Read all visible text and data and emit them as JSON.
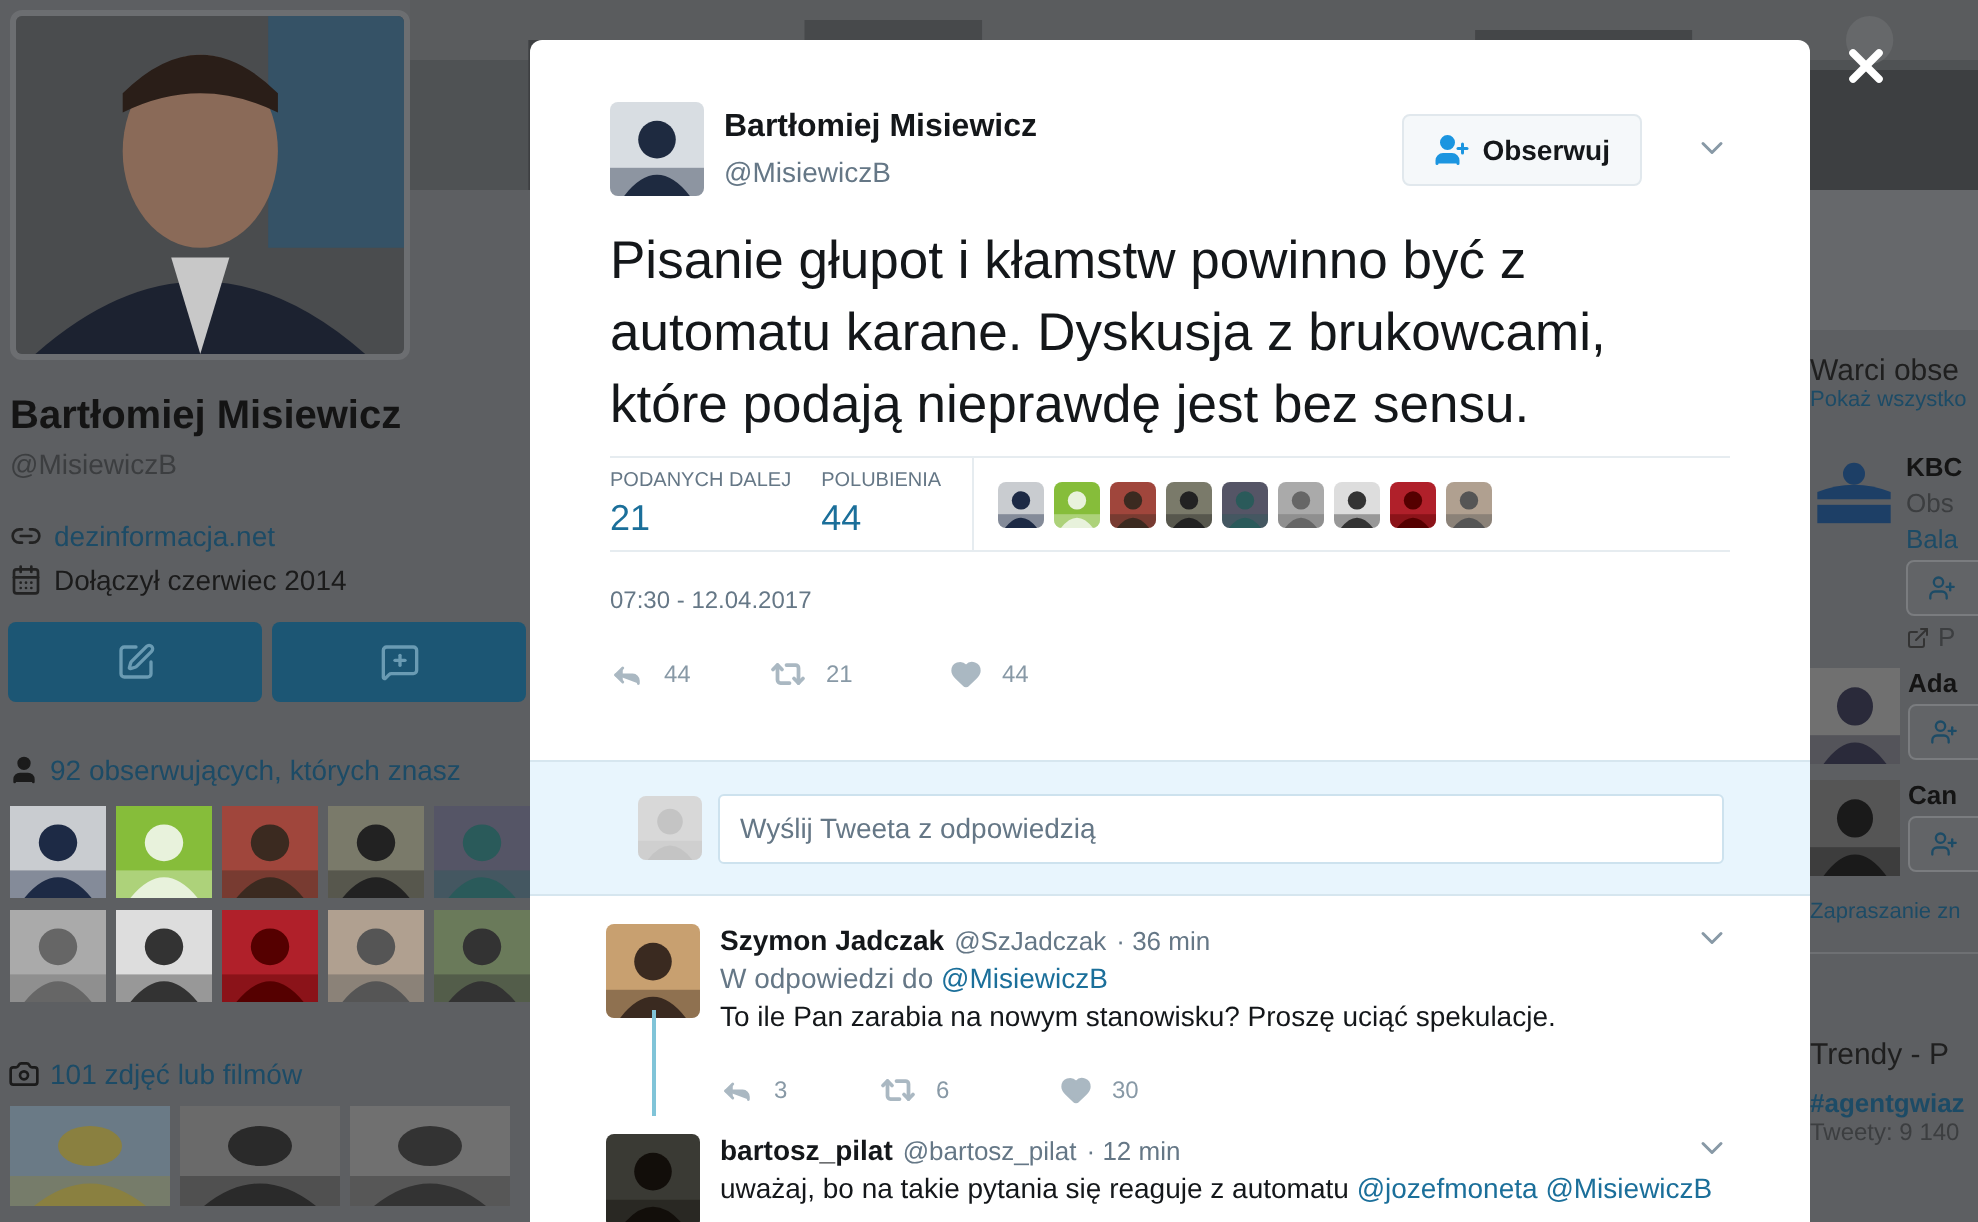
{
  "profile": {
    "name": "Bartłomiej Misiewicz",
    "handle": "@MisiewiczB",
    "link": "dezinformacja.net",
    "joined": "Dołączył czerwiec 2014",
    "followers_label": "92 obserwujących, których znasz",
    "media_label": "101 zdjęć lub filmów"
  },
  "right_column": {
    "title": "Warci obse",
    "show_all": "Pokaż wszystko",
    "suggestions": [
      {
        "kind": "logo",
        "name": "KBC",
        "line_2": "Obs",
        "line_3": "Bala",
        "promoted": "P"
      },
      {
        "kind": "person",
        "name": "Ada"
      },
      {
        "kind": "person",
        "name": "Can"
      }
    ],
    "invite": "Zapraszanie zn",
    "trends_title": "Trendy - P",
    "trend": "#agentgwiaz",
    "trend_count": "Tweety: 9 140"
  },
  "tweet": {
    "name": "Bartłomiej Misiewicz",
    "handle": "@MisiewiczB",
    "follow_label": "Obserwuj",
    "text": "Pisanie głupot i kłamstw powinno być z automatu karane. Dyskusja z brukowcami, które podają nieprawdę jest bez sensu.",
    "stats": [
      {
        "label": "PODANYCH DALEJ",
        "value": "21"
      },
      {
        "label": "POLUBIENIA",
        "value": "44"
      }
    ],
    "date": "07:30 - 12.04.2017",
    "actions": {
      "replies": "44",
      "retweets": "21",
      "likes": "44"
    }
  },
  "reply_box": {
    "placeholder": "Wyślij Tweeta z odpowiedzią"
  },
  "replies": [
    {
      "name": "Szymon Jadczak",
      "handle": "@SzJadczak",
      "time": "· 36 min",
      "reply_to_prefix": "W odpowiedzi do",
      "reply_to": "@MisiewiczB",
      "text": "To ile Pan zarabia na nowym stanowisku? Proszę uciąć spekulacje.",
      "actions": {
        "replies": "3",
        "retweets": "6",
        "likes": "30"
      }
    },
    {
      "name": "bartosz_pilat",
      "handle": "@bartosz_pilat",
      "time": "· 12 min",
      "text": "uważaj, bo na takie pytania się reaguje z automatu",
      "mentions": [
        "@jozefmoneta",
        "@MisiewiczB"
      ]
    }
  ]
}
